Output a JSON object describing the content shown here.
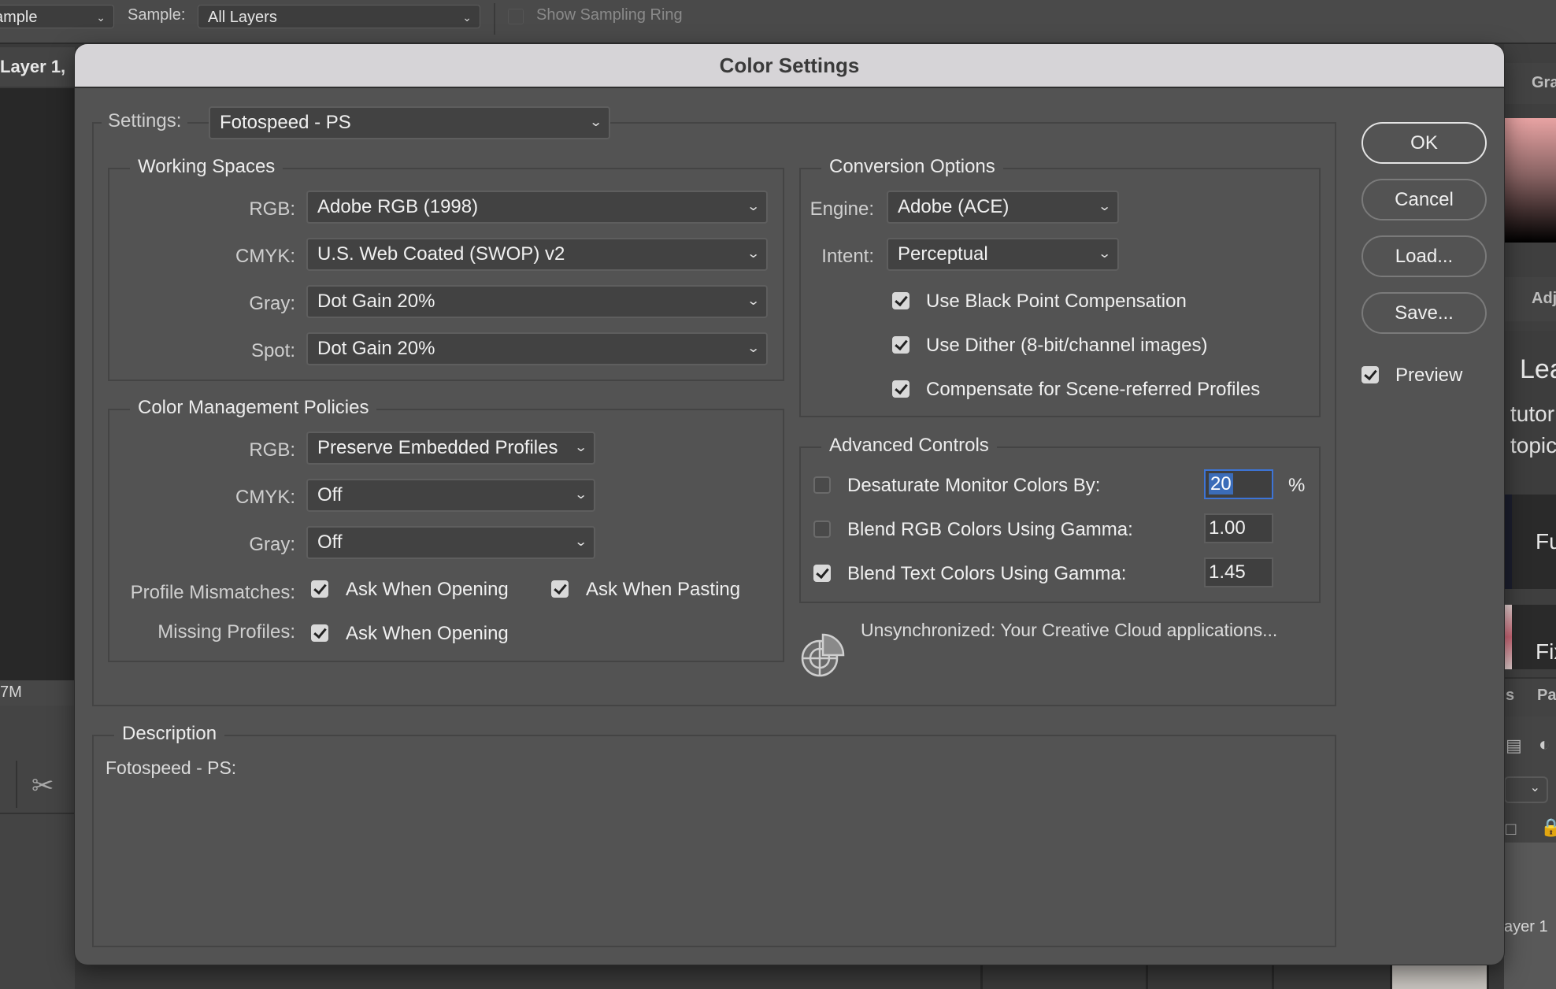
{
  "toolbar": {
    "sample_size_value": "ample",
    "sample_label": "Sample:",
    "sample_value": "All Layers",
    "show_sampling_ring_label": "Show Sampling Ring",
    "show_sampling_ring_checked": false
  },
  "background": {
    "doc_tab_label": "Layer 1,",
    "status_text": "7M",
    "right_tabs": [
      "Gra",
      "Adj"
    ],
    "learn_title": "Lea",
    "learn_subtitle_lines": [
      "tutor",
      "topic"
    ],
    "tutorial_cards": [
      "Fu",
      "Fix"
    ],
    "layers_tabs": [
      "s",
      "Pa"
    ],
    "layer_name": "ayer 1"
  },
  "dialog": {
    "title": "Color Settings",
    "settings_label": "Settings:",
    "settings_value": "Fotospeed - PS",
    "working_spaces": {
      "title": "Working Spaces",
      "rows": [
        {
          "label": "RGB:",
          "value": "Adobe RGB (1998)"
        },
        {
          "label": "CMYK:",
          "value": "U.S. Web Coated (SWOP) v2"
        },
        {
          "label": "Gray:",
          "value": "Dot Gain 20%"
        },
        {
          "label": "Spot:",
          "value": "Dot Gain 20%"
        }
      ]
    },
    "policies": {
      "title": "Color Management Policies",
      "rows": [
        {
          "label": "RGB:",
          "value": "Preserve Embedded Profiles"
        },
        {
          "label": "CMYK:",
          "value": "Off"
        },
        {
          "label": "Gray:",
          "value": "Off"
        }
      ],
      "profile_mismatches_label": "Profile Mismatches:",
      "mismatch_ask_opening": {
        "label": "Ask When Opening",
        "checked": true
      },
      "mismatch_ask_pasting": {
        "label": "Ask When Pasting",
        "checked": true
      },
      "missing_profiles_label": "Missing Profiles:",
      "missing_ask_opening": {
        "label": "Ask When Opening",
        "checked": true
      }
    },
    "conversion": {
      "title": "Conversion Options",
      "engine_label": "Engine:",
      "engine_value": "Adobe (ACE)",
      "intent_label": "Intent:",
      "intent_value": "Perceptual",
      "options": [
        {
          "label": "Use Black Point Compensation",
          "checked": true
        },
        {
          "label": "Use Dither (8-bit/channel images)",
          "checked": true
        },
        {
          "label": "Compensate for Scene-referred Profiles",
          "checked": true
        }
      ]
    },
    "advanced": {
      "title": "Advanced Controls",
      "desaturate": {
        "label": "Desaturate Monitor Colors By:",
        "checked": false,
        "value": "20",
        "unit": "%"
      },
      "blend_rgb": {
        "label": "Blend RGB Colors Using Gamma:",
        "checked": false,
        "value": "1.00"
      },
      "blend_text": {
        "label": "Blend Text Colors Using Gamma:",
        "checked": true,
        "value": "1.45"
      }
    },
    "sync_status": "Unsynchronized: Your Creative Cloud applications...",
    "description": {
      "title": "Description",
      "text": "Fotospeed - PS:"
    },
    "buttons": {
      "ok": "OK",
      "cancel": "Cancel",
      "load": "Load...",
      "save": "Save..."
    },
    "preview": {
      "label": "Preview",
      "checked": true
    },
    "colors": {
      "title_bar": "#d6d4d7",
      "dialog_bg": "#535353",
      "focus_blue": "#3d74d6"
    }
  }
}
